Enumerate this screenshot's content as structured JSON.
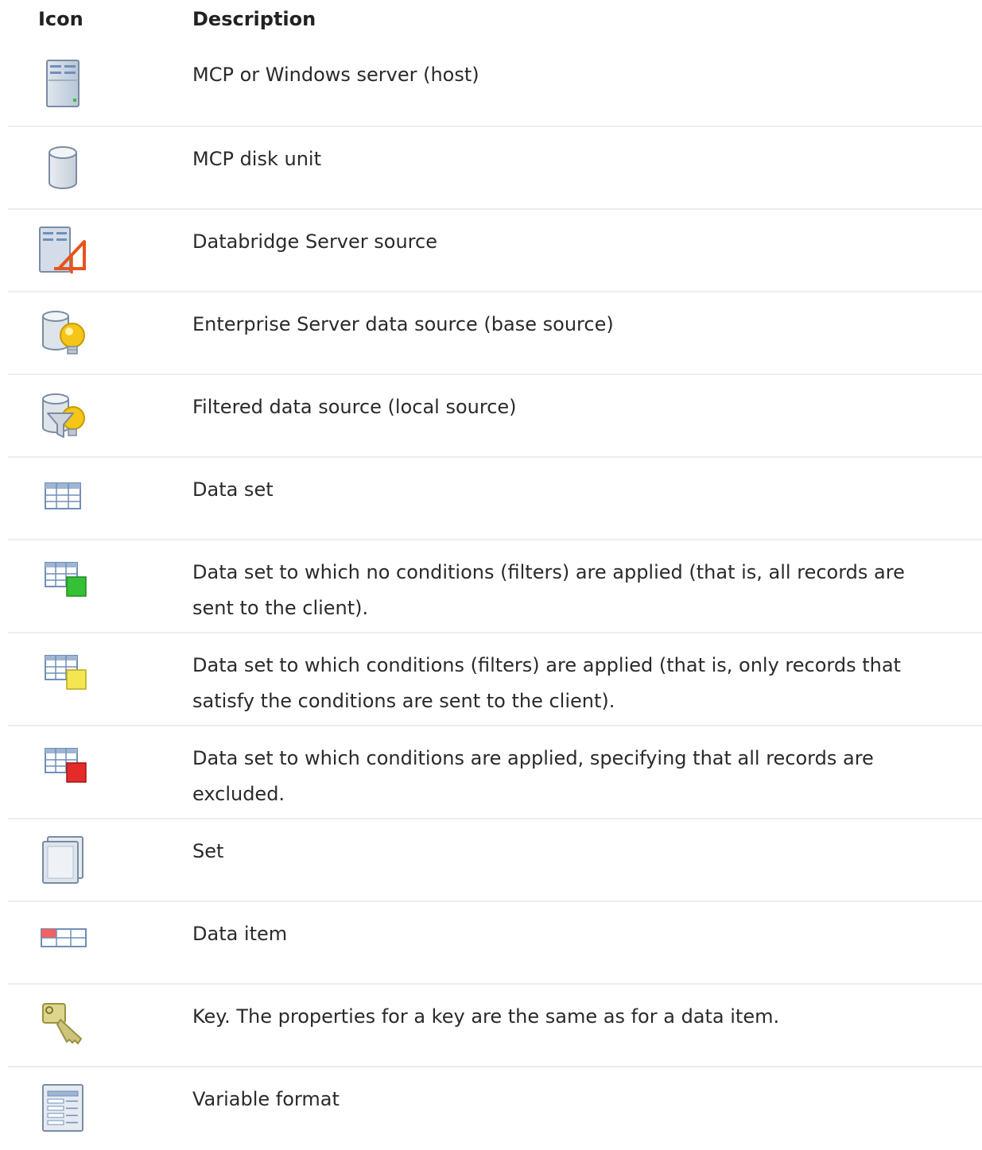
{
  "table": {
    "headers": {
      "icon": "Icon",
      "description": "Description"
    },
    "rows": [
      {
        "icon": "server-icon",
        "description": "MCP or Windows server (host)"
      },
      {
        "icon": "disk-unit-icon",
        "description": "MCP disk unit"
      },
      {
        "icon": "databridge-server-source-icon",
        "description": "Databridge Server source"
      },
      {
        "icon": "enterprise-data-source-icon",
        "description": "Enterprise Server data source (base source)"
      },
      {
        "icon": "filtered-data-source-icon",
        "description": "Filtered data source (local source)"
      },
      {
        "icon": "data-set-icon",
        "description": "Data set"
      },
      {
        "icon": "data-set-green-icon",
        "description": "Data set to which no conditions (filters) are applied (that is, all records are sent to the client)."
      },
      {
        "icon": "data-set-yellow-icon",
        "description": "Data set to which conditions (filters) are applied (that is, only records that satisfy the conditions are sent to the client)."
      },
      {
        "icon": "data-set-red-icon",
        "description": "Data set to which conditions are applied, specifying that all records are excluded."
      },
      {
        "icon": "set-icon",
        "description": "Set"
      },
      {
        "icon": "data-item-icon",
        "description": "Data item"
      },
      {
        "icon": "key-icon",
        "description": "Key. The properties for a key are the same as for a data item."
      },
      {
        "icon": "variable-format-icon",
        "description": "Variable format"
      }
    ]
  },
  "colors": {
    "text": "#222222",
    "divider": "#eeeeee",
    "icon_blue": "#6f8fb8",
    "accent_orange": "#e8531c",
    "bulb_yellow": "#f5c518",
    "status_green": "#35c135",
    "status_yellow": "#f3e651",
    "status_red": "#e52a2a"
  }
}
